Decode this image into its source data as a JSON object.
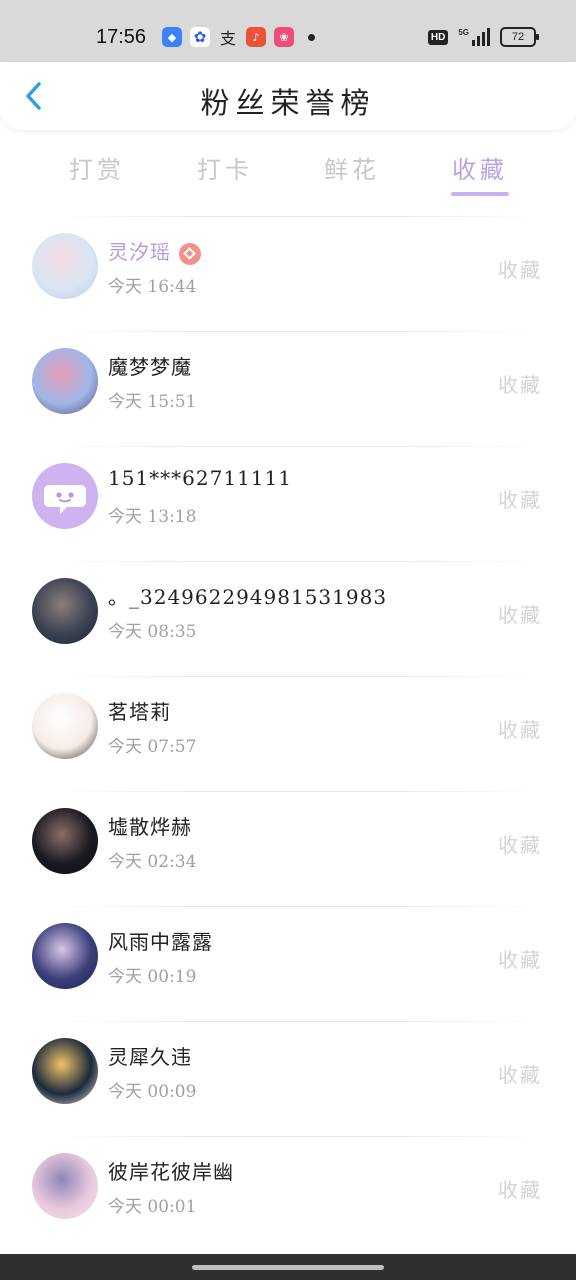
{
  "status_bar": {
    "time": "17:56",
    "apps": [
      {
        "icon": "blue-app-icon",
        "color": "#3b82f6",
        "glyph": "◆"
      },
      {
        "icon": "baidu-paw-icon",
        "color": "#2b5fd9",
        "glyph": "✿"
      },
      {
        "icon": "alipay-icon",
        "color": "#333333",
        "glyph": "支"
      },
      {
        "icon": "music-app-icon",
        "color": "#e8533a",
        "glyph": "♪"
      },
      {
        "icon": "pink-app-icon",
        "color": "#ef4b7d",
        "glyph": "❀"
      }
    ],
    "hd": "HD",
    "network": "5G",
    "battery": "72"
  },
  "header": {
    "title": "粉丝荣誉榜",
    "back_icon": "chevron-left-icon",
    "accent": "#2b9fe0"
  },
  "tabs": [
    {
      "label": "打赏",
      "active": false
    },
    {
      "label": "打卡",
      "active": false
    },
    {
      "label": "鲜花",
      "active": false
    },
    {
      "label": "收藏",
      "active": true
    }
  ],
  "entries": [
    {
      "name": "灵汐瑶",
      "time": "今天 16:44",
      "action": "收藏",
      "highlight": true,
      "badge": "diamond-badge-icon",
      "avatar_colors": [
        "#d9e6f2",
        "#f3d9e3",
        "#b7c9e8"
      ]
    },
    {
      "name": "魔梦梦魔",
      "time": "今天 15:51",
      "action": "收藏",
      "avatar_colors": [
        "#9fb7e8",
        "#e69ab6",
        "#5b4a6e"
      ]
    },
    {
      "name": "151***62711111",
      "time": "今天 13:18",
      "action": "收藏",
      "default_avatar": true,
      "avatar_colors": [
        "#cdb4f0",
        "#ffffff",
        "#b894ea"
      ]
    },
    {
      "name": "。_3249622949815​31983",
      "time": "今天 08:35",
      "action": "收藏",
      "avatar_colors": [
        "#3b4253",
        "#8a7f7a",
        "#1e2230"
      ]
    },
    {
      "name": "茗塔莉",
      "time": "今天 07:57",
      "action": "收藏",
      "avatar_colors": [
        "#f6ece8",
        "#ffffff",
        "#2b2b2b"
      ]
    },
    {
      "name": "墟散烨赫",
      "time": "今天 02:34",
      "action": "收藏",
      "avatar_colors": [
        "#1a1a22",
        "#8a6e6a",
        "#0c0c12"
      ]
    },
    {
      "name": "风雨中露露",
      "time": "今天 00:19",
      "action": "收藏",
      "avatar_colors": [
        "#3c3f7a",
        "#d8c7e8",
        "#22244f"
      ]
    },
    {
      "name": "灵犀久违",
      "time": "今天 00:09",
      "action": "收藏",
      "avatar_colors": [
        "#1c2a3c",
        "#f2c46a",
        "#e8e4da"
      ]
    },
    {
      "name": "彼岸花彼岸幽",
      "time": "今天 00:01",
      "action": "收藏",
      "avatar_colors": [
        "#e8c8dc",
        "#8f86b8",
        "#f4e6ef"
      ]
    }
  ]
}
